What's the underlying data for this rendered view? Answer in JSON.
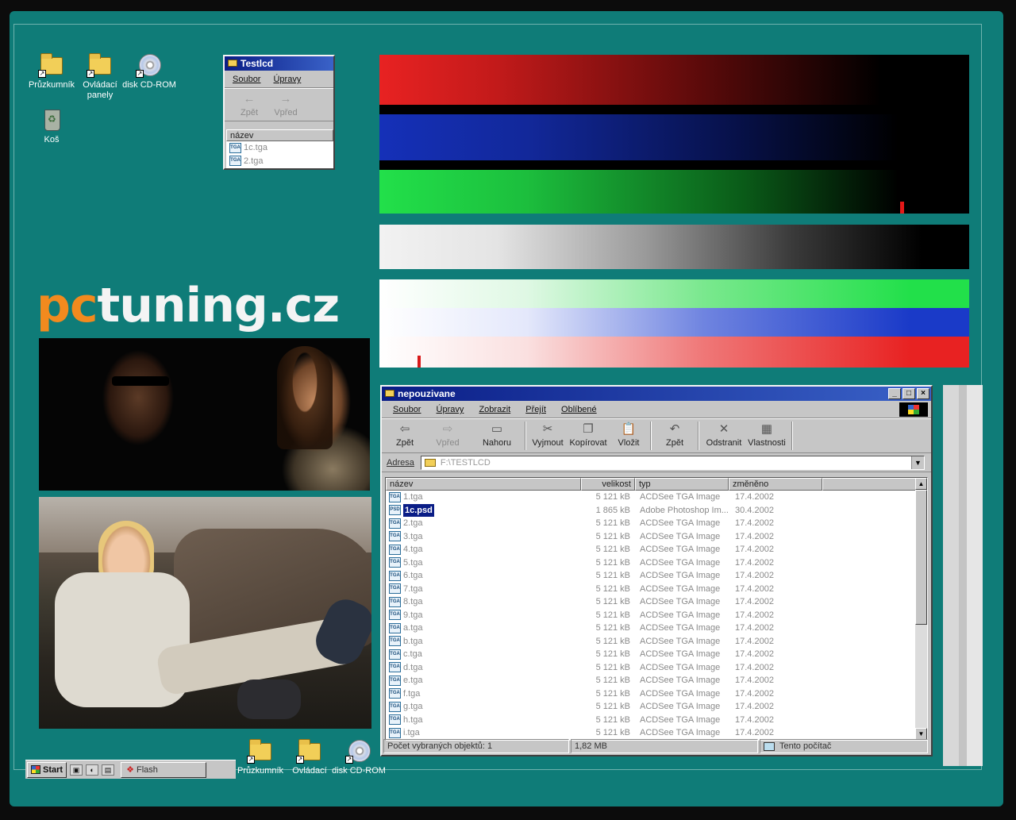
{
  "desktop": {
    "icons_top": [
      {
        "label": "Průzkumník",
        "icon": "explorer-icon"
      },
      {
        "label": "Ovládací panely",
        "icon": "control-panel-icon"
      },
      {
        "label": "disk CD-ROM",
        "icon": "cdrom-icon"
      },
      {
        "label": "Koš",
        "icon": "recycle-bin-icon"
      }
    ],
    "icons_bottom": [
      {
        "label": "Průzkumník",
        "icon": "explorer-icon"
      },
      {
        "label": "Ovládací",
        "icon": "control-panel-icon"
      },
      {
        "label": "disk CD-ROM",
        "icon": "cdrom-icon"
      }
    ],
    "logo": {
      "part1": "pc",
      "part2": "tuning.cz"
    },
    "colors": {
      "background": "#0f7c78",
      "logo_orange": "#f28a1e",
      "logo_white": "#f4f4f4"
    }
  },
  "testlcd_window": {
    "title": "Testlcd",
    "menu": [
      "Soubor",
      "Úpravy"
    ],
    "toolbar": [
      {
        "label": "Zpět",
        "glyph": "←"
      },
      {
        "label": "Vpřed",
        "glyph": "→"
      }
    ],
    "column": "název",
    "files": [
      "1c.tga",
      "2.tga"
    ]
  },
  "explorer": {
    "title": "nepouzivane",
    "menu": [
      "Soubor",
      "Úpravy",
      "Zobrazit",
      "Přejít",
      "Oblíbené"
    ],
    "toolbar": [
      {
        "label": "Zpět",
        "glyph": "⇦",
        "enabled": true
      },
      {
        "label": "Vpřed",
        "glyph": "⇨",
        "enabled": false
      },
      {
        "label": "Nahoru",
        "glyph": "▭",
        "enabled": true
      },
      {
        "label": "Vyjmout",
        "glyph": "✂",
        "enabled": true
      },
      {
        "label": "Kopírovat",
        "glyph": "❐",
        "enabled": true
      },
      {
        "label": "Vložit",
        "glyph": "📋",
        "enabled": true
      },
      {
        "label": "Zpět",
        "glyph": "↶",
        "enabled": true
      },
      {
        "label": "Odstranit",
        "glyph": "✕",
        "enabled": true
      },
      {
        "label": "Vlastnosti",
        "glyph": "▦",
        "enabled": true
      }
    ],
    "address_label": "Adresa",
    "address_value": "F:\\TESTLCD",
    "columns": [
      "název",
      "velikost",
      "typ",
      "změněno"
    ],
    "rows": [
      {
        "name": "1.tga",
        "size": "5 121 kB",
        "type": "ACDSee TGA Image",
        "date": "17.4.2002",
        "selected": false
      },
      {
        "name": "1c.psd",
        "size": "1 865 kB",
        "type": "Adobe Photoshop Im...",
        "date": "30.4.2002",
        "selected": true
      },
      {
        "name": "2.tga",
        "size": "5 121 kB",
        "type": "ACDSee TGA Image",
        "date": "17.4.2002",
        "selected": false
      },
      {
        "name": "3.tga",
        "size": "5 121 kB",
        "type": "ACDSee TGA Image",
        "date": "17.4.2002",
        "selected": false
      },
      {
        "name": "4.tga",
        "size": "5 121 kB",
        "type": "ACDSee TGA Image",
        "date": "17.4.2002",
        "selected": false
      },
      {
        "name": "5.tga",
        "size": "5 121 kB",
        "type": "ACDSee TGA Image",
        "date": "17.4.2002",
        "selected": false
      },
      {
        "name": "6.tga",
        "size": "5 121 kB",
        "type": "ACDSee TGA Image",
        "date": "17.4.2002",
        "selected": false
      },
      {
        "name": "7.tga",
        "size": "5 121 kB",
        "type": "ACDSee TGA Image",
        "date": "17.4.2002",
        "selected": false
      },
      {
        "name": "8.tga",
        "size": "5 121 kB",
        "type": "ACDSee TGA Image",
        "date": "17.4.2002",
        "selected": false
      },
      {
        "name": "9.tga",
        "size": "5 121 kB",
        "type": "ACDSee TGA Image",
        "date": "17.4.2002",
        "selected": false
      },
      {
        "name": "a.tga",
        "size": "5 121 kB",
        "type": "ACDSee TGA Image",
        "date": "17.4.2002",
        "selected": false
      },
      {
        "name": "b.tga",
        "size": "5 121 kB",
        "type": "ACDSee TGA Image",
        "date": "17.4.2002",
        "selected": false
      },
      {
        "name": "c.tga",
        "size": "5 121 kB",
        "type": "ACDSee TGA Image",
        "date": "17.4.2002",
        "selected": false
      },
      {
        "name": "d.tga",
        "size": "5 121 kB",
        "type": "ACDSee TGA Image",
        "date": "17.4.2002",
        "selected": false
      },
      {
        "name": "e.tga",
        "size": "5 121 kB",
        "type": "ACDSee TGA Image",
        "date": "17.4.2002",
        "selected": false
      },
      {
        "name": "f.tga",
        "size": "5 121 kB",
        "type": "ACDSee TGA Image",
        "date": "17.4.2002",
        "selected": false
      },
      {
        "name": "g.tga",
        "size": "5 121 kB",
        "type": "ACDSee TGA Image",
        "date": "17.4.2002",
        "selected": false
      },
      {
        "name": "h.tga",
        "size": "5 121 kB",
        "type": "ACDSee TGA Image",
        "date": "17.4.2002",
        "selected": false
      },
      {
        "name": "i.tga",
        "size": "5 121 kB",
        "type": "ACDSee TGA Image",
        "date": "17.4.2002",
        "selected": false
      }
    ],
    "status": {
      "selected_count": "Počet vybraných objektů: 1",
      "size": "1,82 MB",
      "location": "Tento počítač"
    }
  },
  "taskbar": {
    "start": "Start",
    "task": "Flash"
  },
  "gradients": {
    "colors": {
      "red": "#e82222",
      "blue": "#1530b8",
      "green": "#22e04a",
      "white": "#f2f2f2",
      "black": "#000000"
    }
  }
}
